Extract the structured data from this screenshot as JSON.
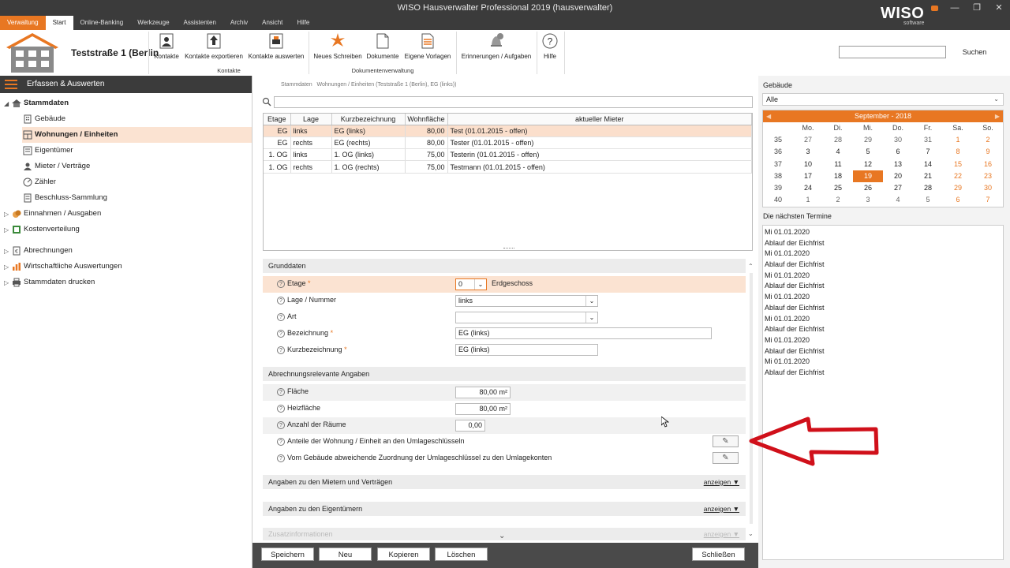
{
  "window": {
    "title": "WISO Hausverwalter Professional 2019 (hausverwalter)",
    "brand": "WISO",
    "brand_sub": "software"
  },
  "menu_tabs": [
    "Verwaltung",
    "Start",
    "Online-Banking",
    "Werkzeuge",
    "Assistenten",
    "Archiv",
    "Ansicht",
    "Hilfe"
  ],
  "ribbon": {
    "address": "Teststraße 1 (Berlin",
    "buttons": {
      "kontakte": "Kontakte",
      "kontakte_exportieren": "Kontakte exportieren",
      "kontakte_auswerten": "Kontakte auswerten",
      "neues_schreiben": "Neues Schreiben",
      "dokumente": "Dokumente",
      "eigene_vorlagen": "Eigene Vorlagen",
      "erinnerungen": "Erinnerungen / Aufgaben",
      "hilfe": "Hilfe"
    },
    "group_kontakte": "Kontakte",
    "group_dokumente": "Dokumentenverwaltung",
    "search_button": "Suchen",
    "search_value": ""
  },
  "nav": {
    "header": "Erfassen & Auswerten",
    "items": [
      {
        "label": "Stammdaten"
      },
      {
        "label": "Gebäude"
      },
      {
        "label": "Wohnungen / Einheiten"
      },
      {
        "label": "Eigentümer"
      },
      {
        "label": "Mieter / Verträge"
      },
      {
        "label": "Zähler"
      },
      {
        "label": "Beschluss-Sammlung"
      },
      {
        "label": "Einnahmen / Ausgaben"
      },
      {
        "label": "Kostenverteilung"
      },
      {
        "label": "Abrechnungen"
      },
      {
        "label": "Wirtschaftliche Auswertungen"
      },
      {
        "label": "Stammdaten drucken"
      }
    ]
  },
  "breadcrumb": {
    "root": "Stammdaten",
    "current": "Wohnungen / Einheiten (Teststraße 1 (Berlin), EG (links))"
  },
  "filter_value": "",
  "units_table": {
    "columns": [
      "Etage",
      "Lage",
      "Kurzbezeichnung",
      "Wohnfläche",
      "aktueller Mieter"
    ],
    "rows": [
      [
        "EG",
        "links",
        "EG (links)",
        "80,00",
        "Test (01.01.2015 - offen)"
      ],
      [
        "EG",
        "rechts",
        "EG (rechts)",
        "80,00",
        "Tester (01.01.2015 - offen)"
      ],
      [
        "1. OG",
        "links",
        "1. OG (links)",
        "75,00",
        "Testerin (01.01.2015 - offen)"
      ],
      [
        "1. OG",
        "rechts",
        "1. OG (rechts)",
        "75,00",
        "Testmann (01.01.2015 - offen)"
      ]
    ]
  },
  "grunddaten": {
    "title": "Grunddaten",
    "etage_label": "Etage",
    "etage_value": "0",
    "etage_text": "Erdgeschoss",
    "lage_label": "Lage / Nummer",
    "lage_value": "links",
    "art_label": "Art",
    "art_value": "",
    "bezeichnung_label": "Bezeichnung",
    "bezeichnung_value": "EG (links)",
    "kurz_label": "Kurzbezeichnung",
    "kurz_value": "EG (links)",
    "required_mark": "*"
  },
  "abrechnung": {
    "title": "Abrechnungsrelevante Angaben",
    "flaeche_label": "Fläche",
    "flaeche_value": "80,00 m²",
    "heiz_label": "Heizfläche",
    "heiz_value": "80,00 m²",
    "raeume_label": "Anzahl der Räume",
    "raeume_value": "0,00",
    "anteile_label": "Anteile der Wohnung / Einheit an den Umlageschlüsseln",
    "zuordnung_label": "Vom Gebäude abweichende Zuordnung der Umlageschlüssel zu den Umlagekonten"
  },
  "sections": {
    "mieter": "Angaben zu den Mietern und Verträgen",
    "eigentuemer": "Angaben zu den Eigentümern",
    "zusatz": "Zusatzinformationen",
    "show_link": "anzeigen ▼"
  },
  "bottom_buttons": {
    "speichern": "Speichern",
    "neu": "Neu",
    "kopieren": "Kopieren",
    "loeschen": "Löschen",
    "schliessen": "Schließen"
  },
  "right_pane": {
    "gebaeude_label": "Gebäude",
    "gebaeude_value": "Alle",
    "calendar_title": "September - 2018",
    "weekdays": [
      "Mo.",
      "Di.",
      "Mi.",
      "Do.",
      "Fr.",
      "Sa.",
      "So."
    ],
    "weeks": [
      {
        "wk": "35",
        "days": [
          "27",
          "28",
          "29",
          "30",
          "31",
          "1",
          "2"
        ]
      },
      {
        "wk": "36",
        "days": [
          "3",
          "4",
          "5",
          "6",
          "7",
          "8",
          "9"
        ]
      },
      {
        "wk": "37",
        "days": [
          "10",
          "11",
          "12",
          "13",
          "14",
          "15",
          "16"
        ]
      },
      {
        "wk": "38",
        "days": [
          "17",
          "18",
          "19",
          "20",
          "21",
          "22",
          "23"
        ]
      },
      {
        "wk": "39",
        "days": [
          "24",
          "25",
          "26",
          "27",
          "28",
          "29",
          "30"
        ]
      },
      {
        "wk": "40",
        "days": [
          "1",
          "2",
          "3",
          "4",
          "5",
          "6",
          "7"
        ]
      }
    ],
    "today": "19",
    "termine_label": "Die nächsten Termine",
    "termine": [
      "Mi 01.01.2020",
      "Ablauf der Eichfrist",
      "Mi 01.01.2020",
      "Ablauf der Eichfrist",
      "Mi 01.01.2020",
      "Ablauf der Eichfrist",
      "Mi 01.01.2020",
      "Ablauf der Eichfrist",
      "Mi 01.01.2020",
      "Ablauf der Eichfrist",
      "Mi 01.01.2020",
      "Ablauf der Eichfrist",
      "Mi 01.01.2020",
      "Ablauf der Eichfrist"
    ]
  },
  "colors": {
    "accent": "#e87722",
    "dark": "#3b3b3b",
    "highlight": "#fbe3d2",
    "annotation_arrow": "#d0101a"
  },
  "icons": [
    "house-icon",
    "contact-icon",
    "export-icon",
    "print-icon",
    "new-letter-icon",
    "document-icon",
    "template-icon",
    "bell-icon",
    "help-icon",
    "search-icon",
    "pencil-icon"
  ]
}
